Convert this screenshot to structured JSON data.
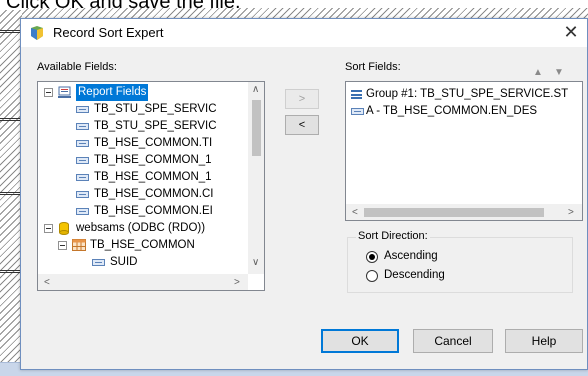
{
  "background": {
    "caption": "Click OK and save the file."
  },
  "dialog": {
    "title": "Record Sort Expert",
    "close_glyph": "✕"
  },
  "available_fields": {
    "label": "Available Fields:",
    "tree": [
      {
        "kind": "group",
        "text": "Report Fields",
        "selected": true
      },
      {
        "kind": "field",
        "text": "TB_STU_SPE_SERVIC"
      },
      {
        "kind": "field",
        "text": "TB_STU_SPE_SERVIC"
      },
      {
        "kind": "field",
        "text": "TB_HSE_COMMON.TI"
      },
      {
        "kind": "field",
        "text": "TB_HSE_COMMON_1"
      },
      {
        "kind": "field",
        "text": "TB_HSE_COMMON_1"
      },
      {
        "kind": "field",
        "text": "TB_HSE_COMMON.CI"
      },
      {
        "kind": "field",
        "text": "TB_HSE_COMMON.EI"
      },
      {
        "kind": "database",
        "text": "websams (ODBC (RDO))"
      },
      {
        "kind": "table",
        "text": "TB_HSE_COMMON"
      },
      {
        "kind": "field",
        "text": "SUID"
      }
    ]
  },
  "move_buttons": {
    "add_label": ">",
    "remove_label": "<"
  },
  "sort_fields": {
    "label": "Sort Fields:",
    "up_arrow": "▲",
    "down_arrow": "▼",
    "items": [
      {
        "kind": "group",
        "text": "Group #1: TB_STU_SPE_SERVICE.ST"
      },
      {
        "kind": "field",
        "text": "A - TB_HSE_COMMON.EN_DES"
      }
    ]
  },
  "sort_direction": {
    "legend": "Sort Direction:",
    "options": [
      {
        "label": "Ascending",
        "checked": true
      },
      {
        "label": "Descending",
        "checked": false
      }
    ]
  },
  "buttons": {
    "ok": "OK",
    "cancel": "Cancel",
    "help": "Help"
  },
  "scroll": {
    "up": "∧",
    "down": "∨",
    "left": "<",
    "right": ">"
  }
}
